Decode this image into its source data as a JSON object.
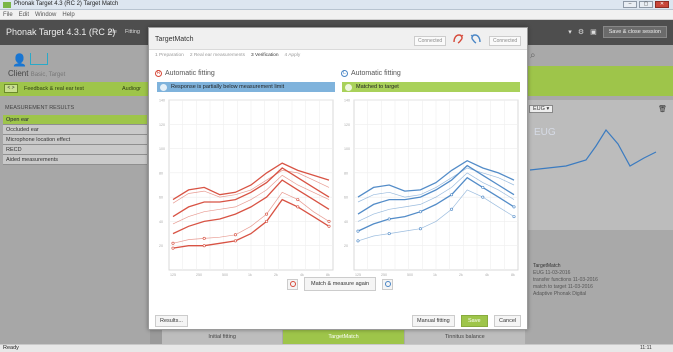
{
  "os_window": {
    "title": "Phonak Target 4.3 (RC 2) Target Match",
    "menu": [
      "File",
      "Edit",
      "Window",
      "Help"
    ],
    "controls": [
      "–",
      "▢",
      "✕"
    ]
  },
  "app_header": {
    "title": "Phonak Target 4.3.1 (RC 2)",
    "menu1": "File",
    "menu2": "Fitting",
    "save_close_label": "Save & close session",
    "icon_chevron": "▾"
  },
  "client": {
    "label": "Client",
    "name": "Basic, Target"
  },
  "green_bar": {
    "arrows": "< >",
    "tab_label": "Feedback & real ear test",
    "tab2_label": "Audiogr"
  },
  "measurement_results": {
    "title": "MEASUREMENT RESULTS",
    "items": [
      "Open ear",
      "Occluded ear",
      "Microphone location effect",
      "RECD",
      "Aided measurements"
    ],
    "selected_index": 0
  },
  "status_left": "Ready",
  "right_panel": {
    "selector": "EUG ▾",
    "chart_label": "EUG",
    "info_lines": [
      "TargetMatch",
      "EUG 11-03-2016",
      "transfer functions 11-03-2016",
      "match to target 11-03-2016",
      "Adaptive Phonak Digital"
    ],
    "clock": "11:11"
  },
  "bottom_tabs": [
    {
      "label": "Initial fitting",
      "active": false
    },
    {
      "label": "TargetMatch",
      "active": true
    },
    {
      "label": "Tinnitus balance",
      "active": false
    }
  ],
  "dialog": {
    "title": "TargetMatch",
    "connected_left": "Connected",
    "connected_right": "Connected",
    "steps": [
      {
        "label": "1  Preparation",
        "current": false
      },
      {
        "label": "2  Real ear measurements",
        "current": false
      },
      {
        "label": "3  Verification",
        "current": true
      },
      {
        "label": "4  Apply",
        "current": false
      }
    ],
    "left_panel": {
      "title": "Automatic fitting",
      "banner": "Response is partially below measurement limit"
    },
    "right_panel": {
      "title": "Automatic fitting",
      "banner": "Matched to target"
    },
    "match_button": "Match & measure again",
    "results_button": "Results...",
    "manual_button": "Manual fitting",
    "save_button": "Save",
    "cancel_button": "Cancel"
  },
  "chart_data": [
    {
      "type": "line",
      "title": "",
      "ylim": [
        0,
        140
      ],
      "y_ticks": [
        140,
        120,
        100,
        80,
        60,
        40,
        20
      ],
      "x_ticks": [
        "125",
        "250",
        "500",
        "1k",
        "2k",
        "4k",
        "8k"
      ],
      "color": "#d64a3a",
      "series": [
        {
          "values": [
            58,
            66,
            68,
            62,
            64,
            70,
            80,
            88,
            82,
            78,
            74
          ]
        },
        {
          "values": [
            55,
            63,
            65,
            60,
            62,
            66,
            74,
            82,
            80,
            74,
            68
          ]
        },
        {
          "values": [
            44,
            52,
            56,
            56,
            58,
            64,
            72,
            84,
            76,
            68,
            60
          ]
        },
        {
          "values": [
            38,
            44,
            48,
            50,
            52,
            58,
            66,
            78,
            70,
            64,
            58
          ]
        },
        {
          "values": [
            30,
            36,
            40,
            42,
            46,
            52,
            60,
            74,
            66,
            58,
            50
          ]
        },
        {
          "values": [
            22,
            25,
            26,
            27,
            29,
            36,
            46,
            64,
            58,
            48,
            40
          ]
        },
        {
          "values": [
            18,
            20,
            20,
            22,
            24,
            30,
            40,
            58,
            52,
            44,
            36
          ]
        }
      ]
    },
    {
      "type": "line",
      "title": "",
      "ylim": [
        0,
        140
      ],
      "y_ticks": [
        140,
        120,
        100,
        80,
        60,
        40,
        20
      ],
      "x_ticks": [
        "125",
        "250",
        "500",
        "1k",
        "2k",
        "4k",
        "8k"
      ],
      "color": "#4a86c5",
      "series": [
        {
          "values": [
            60,
            68,
            70,
            65,
            66,
            72,
            82,
            90,
            84,
            80,
            74
          ]
        },
        {
          "values": [
            56,
            62,
            64,
            60,
            62,
            68,
            76,
            84,
            80,
            76,
            70
          ]
        },
        {
          "values": [
            46,
            54,
            58,
            58,
            60,
            66,
            74,
            86,
            78,
            70,
            62
          ]
        },
        {
          "values": [
            40,
            46,
            50,
            52,
            54,
            60,
            68,
            80,
            72,
            66,
            58
          ]
        },
        {
          "values": [
            32,
            38,
            42,
            44,
            48,
            54,
            62,
            76,
            68,
            60,
            52
          ]
        },
        {
          "values": [
            24,
            28,
            30,
            32,
            34,
            40,
            50,
            66,
            60,
            52,
            44
          ]
        }
      ]
    }
  ]
}
